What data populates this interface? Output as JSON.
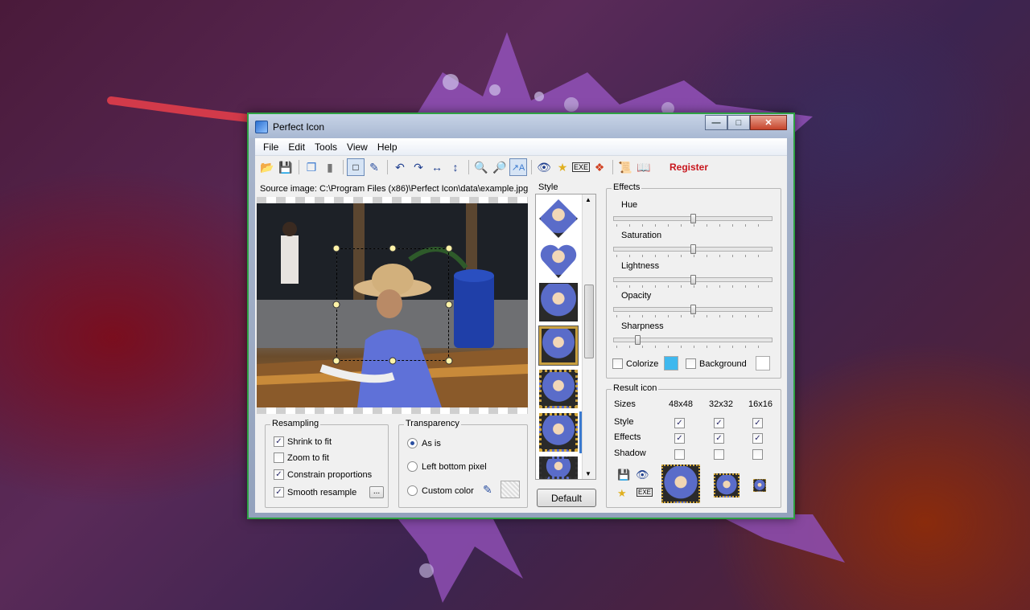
{
  "window": {
    "title": "Perfect Icon",
    "min": "0",
    "max": "1",
    "close": "r"
  },
  "menu": [
    "File",
    "Edit",
    "Tools",
    "View",
    "Help"
  ],
  "toolbar": {
    "register": "Register"
  },
  "source": {
    "label": "Source image: C:\\Program Files (x86)\\Perfect Icon\\data\\example.jpg"
  },
  "resampling": {
    "title": "Resampling",
    "options": [
      {
        "label": "Shrink to fit",
        "checked": true
      },
      {
        "label": "Zoom to fit",
        "checked": false
      },
      {
        "label": "Constrain proportions",
        "checked": true
      },
      {
        "label": "Smooth resample",
        "checked": true
      }
    ],
    "more_button": "..."
  },
  "transparency": {
    "title": "Transparency",
    "options": [
      {
        "label": "As is",
        "selected": true
      },
      {
        "label": "Left bottom pixel",
        "selected": false
      },
      {
        "label": "Custom color",
        "selected": false
      }
    ]
  },
  "style": {
    "title": "Style",
    "default_button": "Default"
  },
  "effects": {
    "title": "Effects",
    "sliders": [
      {
        "label": "Hue",
        "value": 0.5
      },
      {
        "label": "Saturation",
        "value": 0.5
      },
      {
        "label": "Lightness",
        "value": 0.5
      },
      {
        "label": "Opacity",
        "value": 0.5
      },
      {
        "label": "Sharpness",
        "value": 0.14
      }
    ],
    "colorize": {
      "label": "Colorize",
      "checked": false,
      "color": "#3fb8ee"
    },
    "background": {
      "label": "Background",
      "checked": false,
      "color": "#ffffff"
    }
  },
  "result": {
    "title": "Result icon",
    "headers": [
      "Sizes",
      "48x48",
      "32x32",
      "16x16"
    ],
    "rows": [
      {
        "label": "Style",
        "values": [
          true,
          true,
          true
        ]
      },
      {
        "label": "Effects",
        "values": [
          true,
          true,
          true
        ]
      },
      {
        "label": "Shadow",
        "values": [
          false,
          false,
          false
        ]
      }
    ]
  },
  "colors": {
    "window_border": "#2ea043",
    "register": "#c8161d",
    "accent": "#2a4fa0"
  }
}
